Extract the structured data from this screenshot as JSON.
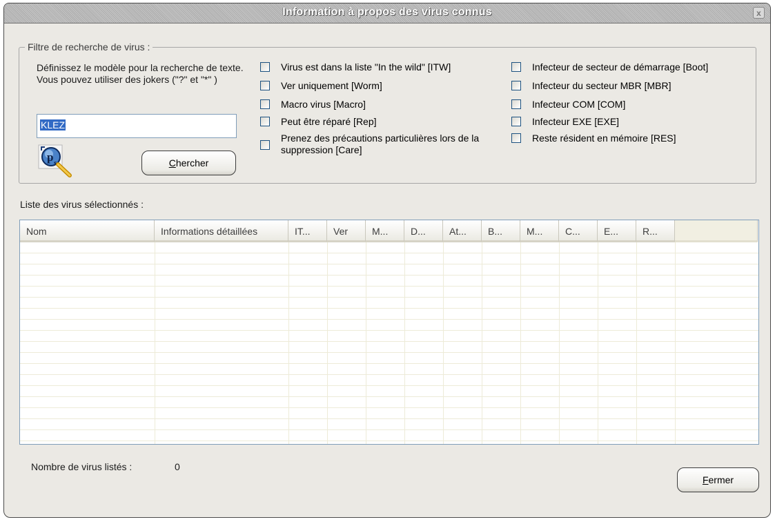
{
  "window": {
    "title": "Information à propos des virus connus",
    "close_glyph": "x"
  },
  "filter": {
    "legend": "Filtre de recherche de virus :",
    "description": "Définissez le modèle pour la recherche de texte. Vous pouvez utiliser des jokers (\"?\" et \"*\" )",
    "search_value": "KLEZ",
    "icon": "ps-magnifier-icon",
    "search_button": {
      "underlined": "C",
      "rest": "hercher"
    },
    "checkboxes_left": [
      {
        "label": "Virus est dans la liste \"In the wild\" [ITW]",
        "checked": false
      },
      {
        "label": "Ver uniquement [Worm]",
        "checked": false
      },
      {
        "label": "Macro virus [Macro]",
        "checked": false
      },
      {
        "label": "Peut être réparé [Rep]",
        "checked": false
      },
      {
        "label": "Prenez des précautions particulières lors de la suppression [Care]",
        "checked": false
      }
    ],
    "checkboxes_right": [
      {
        "label": "Infecteur de secteur de démarrage [Boot]",
        "checked": false
      },
      {
        "label": "Infecteur du secteur MBR [MBR]",
        "checked": false
      },
      {
        "label": "Infecteur COM [COM]",
        "checked": false
      },
      {
        "label": "Infecteur EXE [EXE]",
        "checked": false
      },
      {
        "label": "Reste résident en mémoire [RES]",
        "checked": false
      }
    ]
  },
  "list": {
    "label": "Liste des virus sélectionnés :",
    "columns": [
      "Nom",
      "Informations détaillées",
      "IT...",
      "Ver",
      "M...",
      "D...",
      "At...",
      "B...",
      "M...",
      "C...",
      "E...",
      "R..."
    ],
    "rows": []
  },
  "footer": {
    "count_label": "Nombre de virus listés :",
    "count_value": "0",
    "close_button": {
      "underlined": "F",
      "rest": "ermer"
    }
  },
  "colors": {
    "window_bg": "#ebe9e4",
    "selection": "#316ac5",
    "border_blue": "#7f9db9"
  }
}
